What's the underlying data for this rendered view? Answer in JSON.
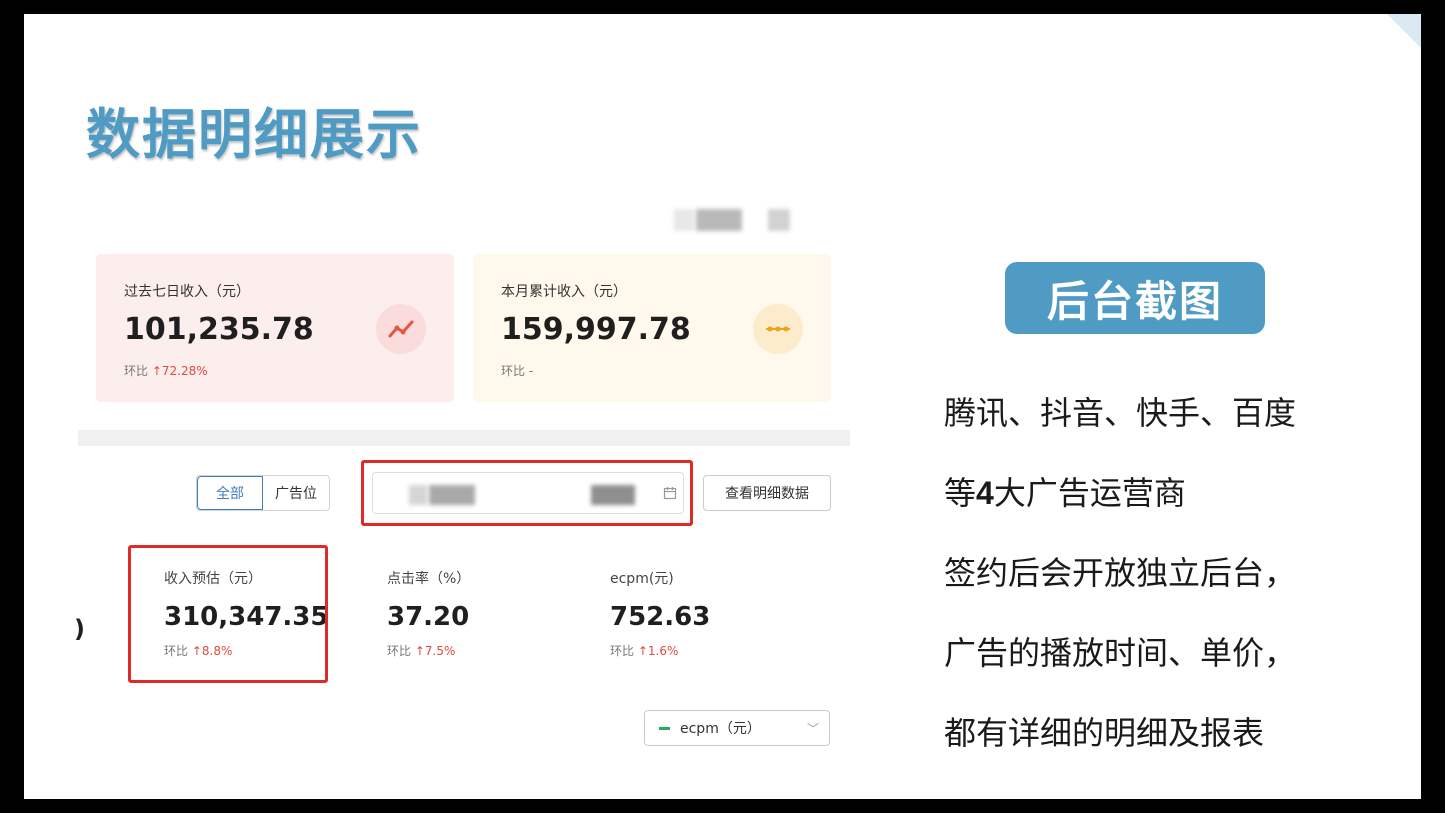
{
  "slide": {
    "title": "数据明细展示",
    "badge": "后台截图",
    "description": {
      "line1": "腾讯、抖音、快手、百度",
      "line2_pre": "等",
      "line2_num": "4",
      "line2_post": "大广告运营商",
      "line3": "签约后会开放独立后台，",
      "line4": "广告的播放时间、单价，",
      "line5": "都有详细的明细及报表"
    }
  },
  "dashboard": {
    "cards": [
      {
        "label": "过去七日收入（元）",
        "value": "101,235.78",
        "compare_label": "环比 ",
        "compare_value": "↑72.28%",
        "icon": "trend-line-icon"
      },
      {
        "label": "本月累计收入（元）",
        "value": "159,997.78",
        "compare_label": "环比 -",
        "compare_value": "",
        "icon": "flat-line-icon"
      }
    ],
    "filter": {
      "segments": [
        "全部",
        "广告位"
      ],
      "active_segment": "全部",
      "date_icon": "calendar-icon",
      "detail_button": "查看明细数据"
    },
    "edge_glyph": ")",
    "metrics": [
      {
        "label": "收入预估（元）",
        "value": "310,347.35",
        "compare_label": "环比 ",
        "compare_value": "↑8.8%"
      },
      {
        "label": "点击率（%）",
        "value": "37.20",
        "compare_label": "环比 ",
        "compare_value": "↑7.5%"
      },
      {
        "label": "ecpm(元)",
        "value": "752.63",
        "compare_label": "环比 ",
        "compare_value": "↑1.6%"
      }
    ],
    "series_select": {
      "value": "ecpm（元）",
      "legend_color": "#2aa95a",
      "chevron": "chevron-down-icon"
    }
  },
  "colors": {
    "accent": "#4f9bc4",
    "highlight": "#e02b24",
    "up": "#e04a3f"
  }
}
